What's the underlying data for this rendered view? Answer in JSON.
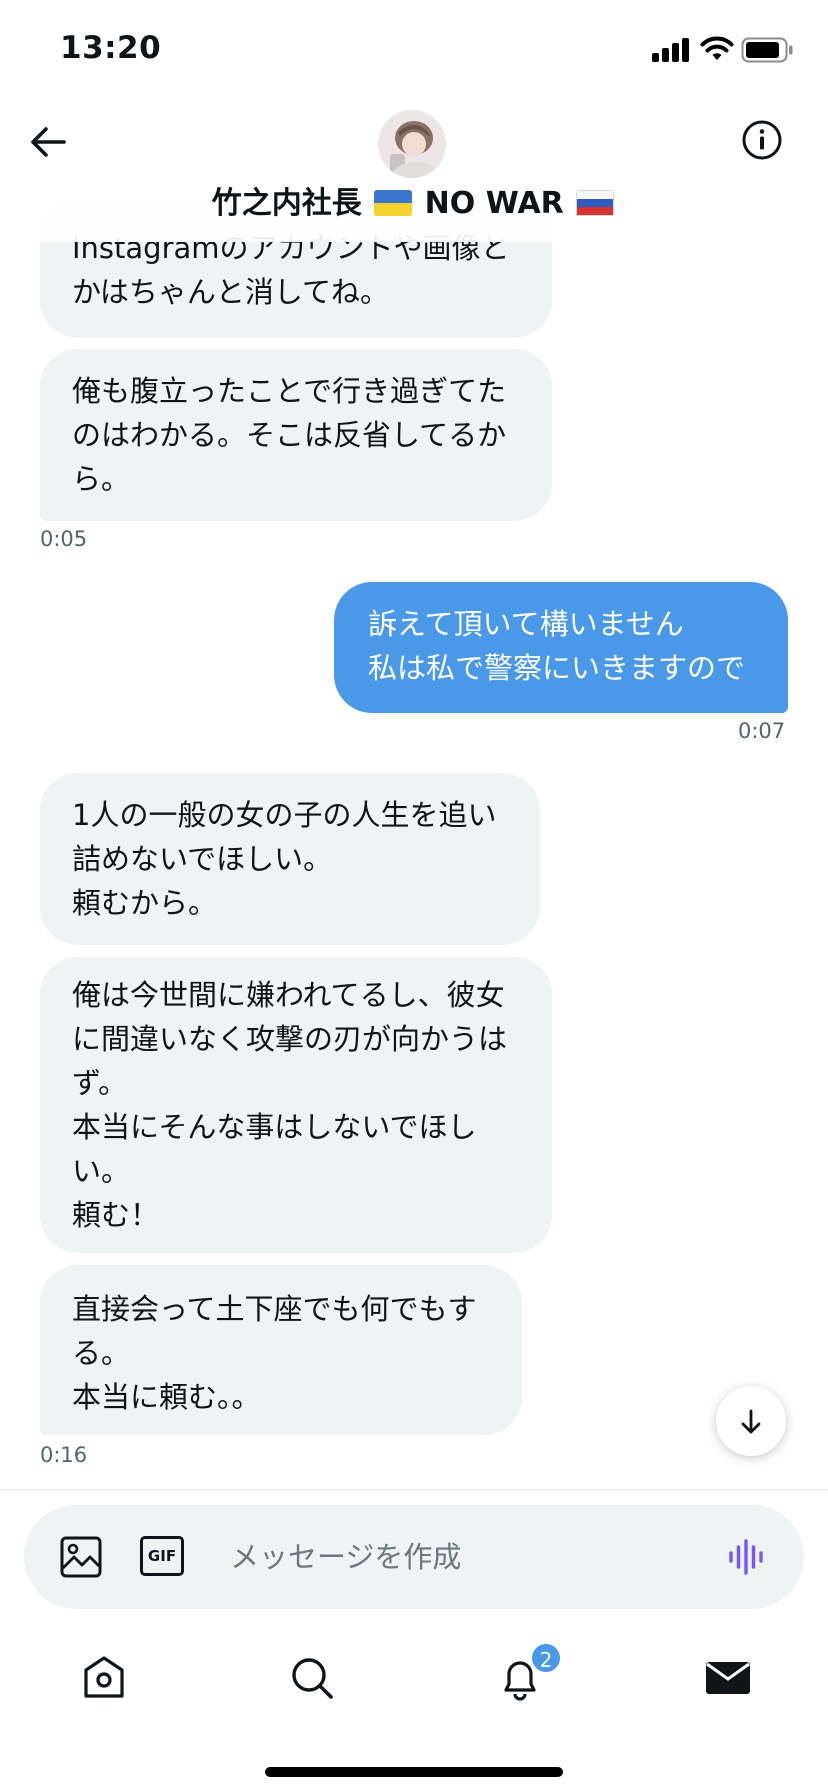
{
  "status_bar": {
    "time": "13:20"
  },
  "header": {
    "name": "竹之内社長",
    "name_suffix": "NO WAR"
  },
  "messages": [
    {
      "side": "in",
      "text": "Instagramのアカウントや画像と\nかはちゃんと消してね。"
    },
    {
      "side": "in",
      "text": "俺も腹立ったことで行き過ぎてた\nのはわかる。そこは反省してるか\nら。"
    },
    {
      "side": "out",
      "text": "訴えて頂いて構いません\n私は私で警察にいきますので"
    },
    {
      "side": "in",
      "text": "1人の一般の女の子の人生を追い\n詰めないでほしい。\n頼むから。"
    },
    {
      "side": "in",
      "text": "俺は今世間に嫌われてるし、彼女\nに間違いなく攻撃の刃が向かうは\nず。\n本当にそんな事はしないでほし\nい。\n頼む！"
    },
    {
      "side": "in",
      "text": "直接会って土下座でも何でもす\nる。\n本当に頼む。。"
    }
  ],
  "timestamps": [
    "0:05",
    "0:07",
    "0:16"
  ],
  "composer": {
    "placeholder": "メッセージを作成",
    "gif_label": "GIF"
  },
  "tabbar": {
    "notifications_badge": "2"
  },
  "icons": [
    "back-arrow-icon",
    "info-icon",
    "image-icon",
    "gif-icon",
    "voice-icon",
    "scroll-down-icon",
    "home-icon",
    "search-icon",
    "bell-icon",
    "mail-icon"
  ],
  "colors": {
    "accent": "#4a99e9",
    "incoming_bubble": "#eff3f4",
    "voice": "#7856ff"
  }
}
